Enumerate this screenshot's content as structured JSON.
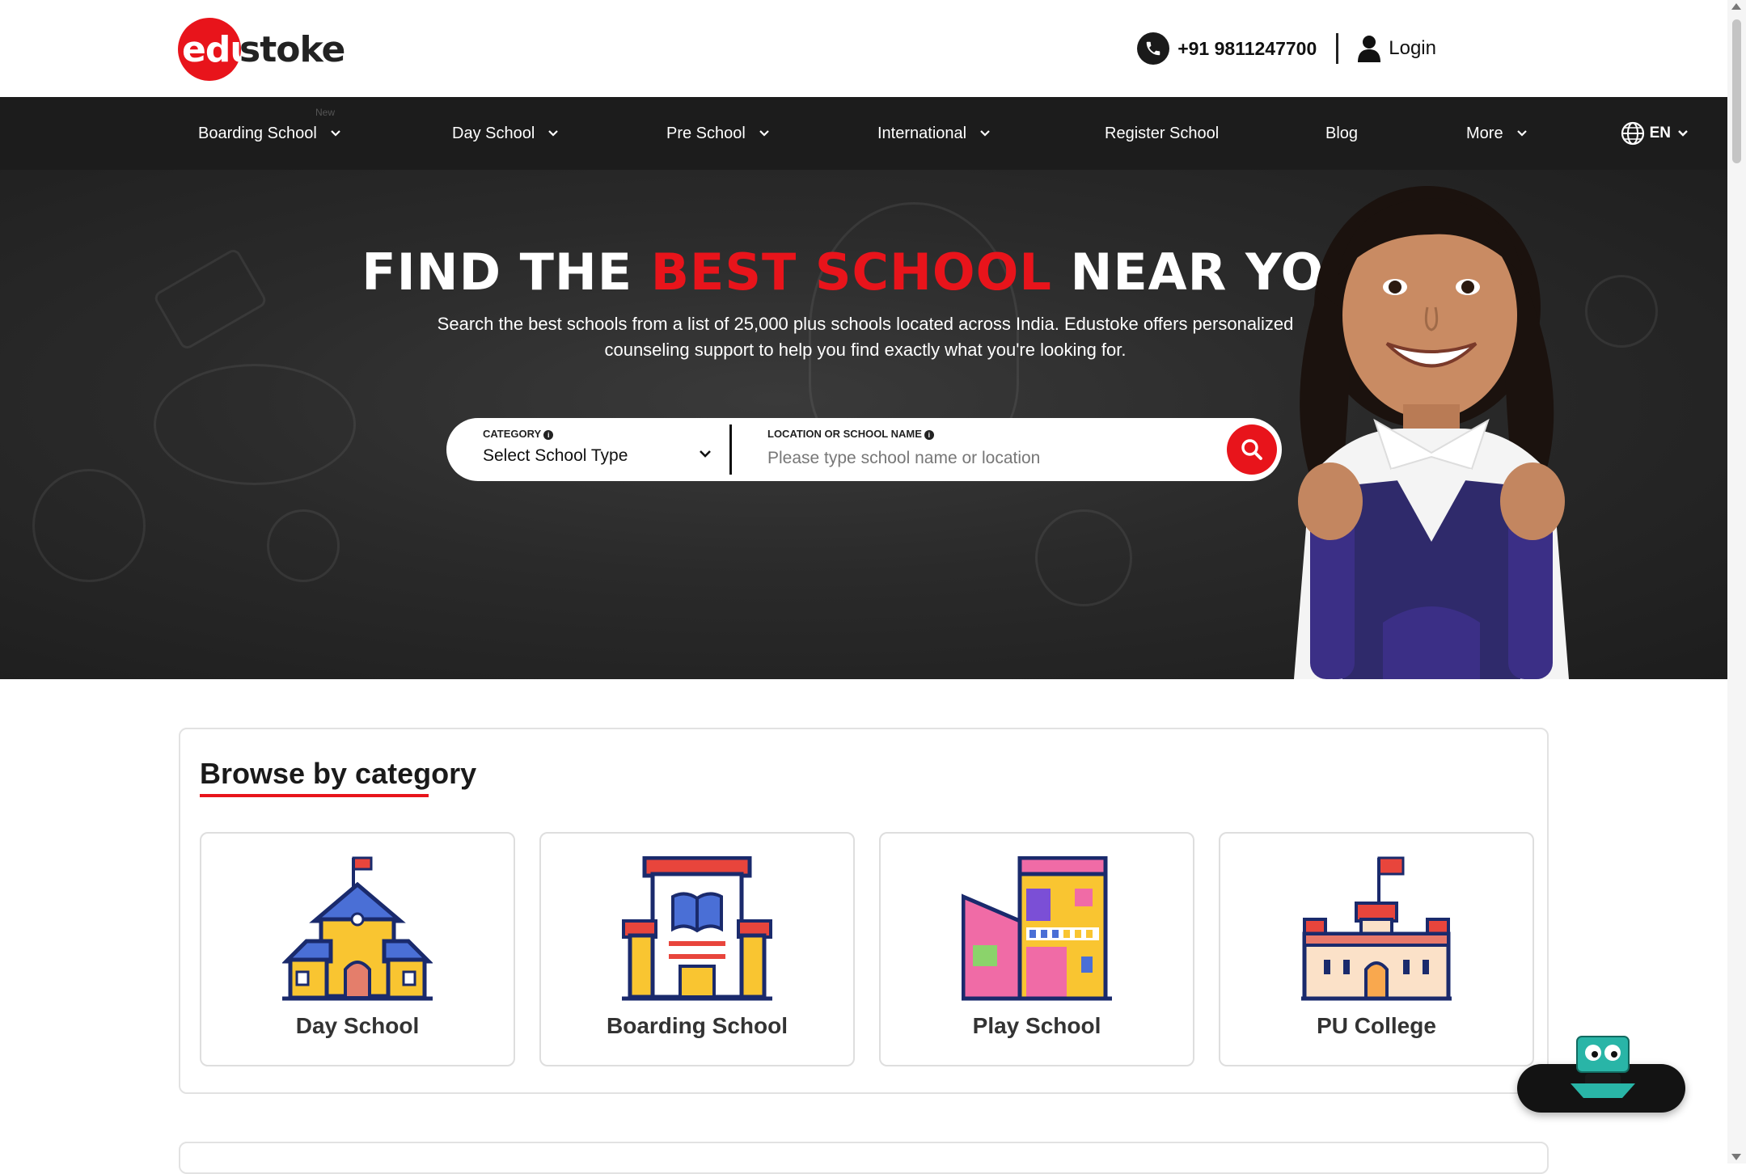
{
  "header": {
    "logo_part1": "edu",
    "logo_part2": "stoke",
    "phone": "+91 9811247700",
    "login": "Login"
  },
  "nav": {
    "items": [
      {
        "label": "Boarding School",
        "dropdown": true
      },
      {
        "label": "Day School",
        "dropdown": true
      },
      {
        "label": "Pre School",
        "dropdown": true
      },
      {
        "label": "International",
        "dropdown": true
      },
      {
        "label": "Register School",
        "dropdown": false
      },
      {
        "label": "Blog",
        "dropdown": false
      },
      {
        "label": "More",
        "dropdown": true
      }
    ],
    "new_badge": "New",
    "language": "EN"
  },
  "hero": {
    "title_part1": "FIND THE ",
    "title_highlight": "BEST SCHOOL",
    "title_part2": " NEAR YOU",
    "subtitle": "Search the best schools from a list of 25,000 plus schools located across India. Edustoke offers personalized counseling support to help you find exactly what you're looking for.",
    "search": {
      "category_label": "CATEGORY",
      "category_value": "Select School Type",
      "location_label": "LOCATION OR SCHOOL NAME",
      "location_placeholder": "Please type school name or location"
    }
  },
  "browse": {
    "title": "Browse by category",
    "categories": [
      {
        "label": "Day School",
        "icon": "day-school-icon"
      },
      {
        "label": "Boarding School",
        "icon": "boarding-school-icon"
      },
      {
        "label": "Play School",
        "icon": "play-school-icon"
      },
      {
        "label": "PU College",
        "icon": "pu-college-icon"
      }
    ]
  },
  "colors": {
    "brand_red": "#e8141b",
    "nav_bg": "#1c1c1c",
    "hero_bg": "#2a2a2a",
    "text_dark": "#1a1a1a"
  }
}
